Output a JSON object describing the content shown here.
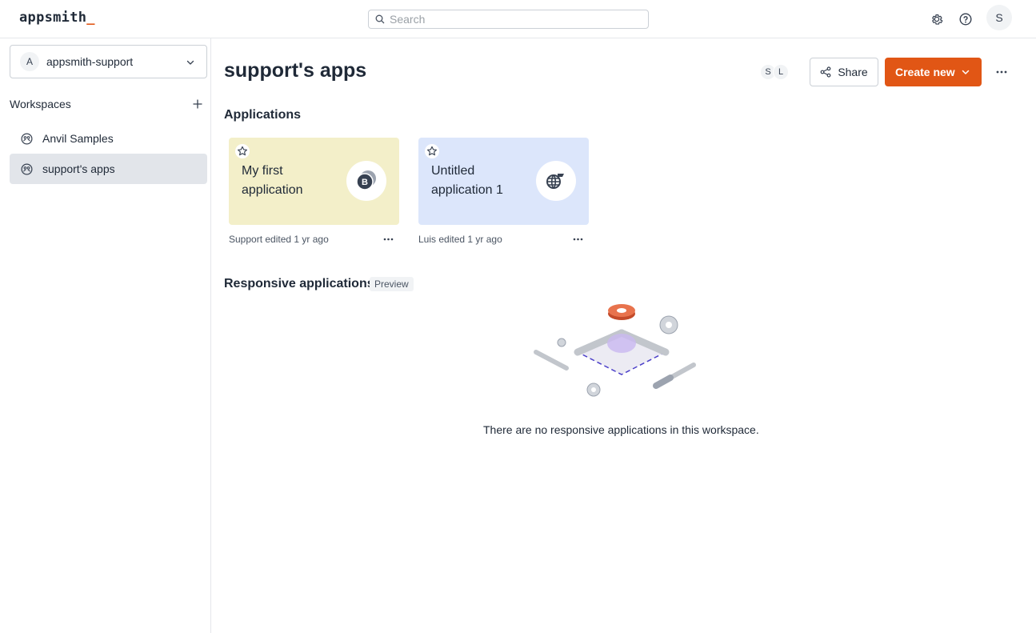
{
  "header": {
    "logo_text": "appsmith",
    "logo_cursor": "_",
    "search_placeholder": "Search",
    "settings_icon": "gear-icon",
    "help_icon": "question-circle-icon",
    "user_initial": "S"
  },
  "sidebar": {
    "workspace_selector": {
      "initial": "A",
      "name": "appsmith-support"
    },
    "heading": "Workspaces",
    "items": [
      {
        "label": "Anvil Samples",
        "icon": "workspace-icon",
        "active": false
      },
      {
        "label": "support's apps",
        "icon": "workspace-icon",
        "active": true
      }
    ]
  },
  "main": {
    "title": "support's apps",
    "members": [
      "S",
      "L"
    ],
    "share_label": "Share",
    "create_label": "Create new",
    "applications_heading": "Applications",
    "apps": [
      {
        "name": "My first application",
        "meta": "Support edited 1 yr ago",
        "icon": "bitcoin-icon",
        "color": "#f3efc9"
      },
      {
        "name": "Untitled application 1",
        "meta": "Luis edited 1 yr ago",
        "icon": "globe-icon",
        "color": "#dce6fb"
      }
    ],
    "responsive_heading": "Responsive applications",
    "preview_badge": "Preview",
    "empty_message": "There are no responsive applications in this workspace."
  },
  "colors": {
    "accent": "#e15615",
    "active_item": "#e2e5ea",
    "app_yellow": "#f3efc9",
    "app_blue": "#dce6fb"
  }
}
